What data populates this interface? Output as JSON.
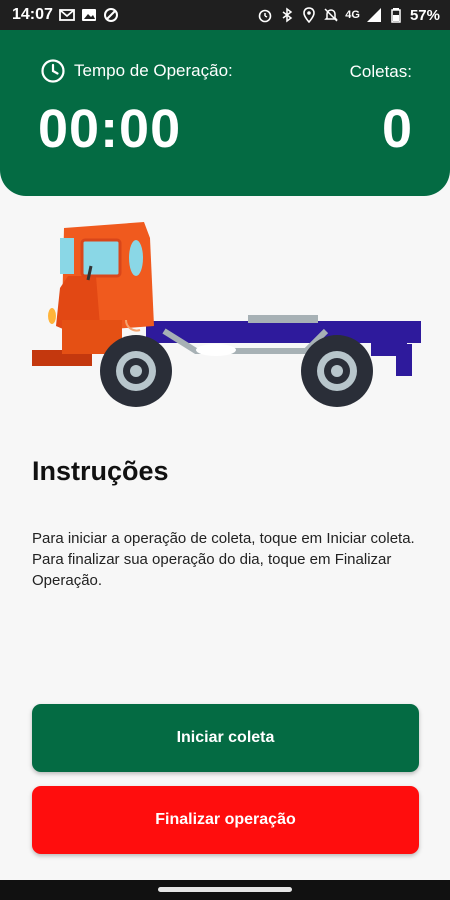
{
  "status_bar": {
    "time": "14:07",
    "network": "4G",
    "battery": "57%"
  },
  "header": {
    "operation_time_label": "Tempo de Operação:",
    "operation_time_value": "00:00",
    "collections_label": "Coletas:",
    "collections_value": "0"
  },
  "instructions": {
    "title": "Instruções",
    "line1": "Para iniciar a operação de coleta, toque em Iniciar coleta.",
    "line2": "Para finalizar sua operação do dia, toque em Finalizar Operação."
  },
  "buttons": {
    "start": "Iniciar coleta",
    "finish": "Finalizar operação"
  },
  "colors": {
    "primary_green": "#046b43",
    "danger_red": "#ff0d0d",
    "truck_cab": "#f05a1e",
    "truck_chassis": "#2e1a9c"
  },
  "icons": {
    "clock": "clock-icon",
    "truck": "truck-illustration"
  }
}
